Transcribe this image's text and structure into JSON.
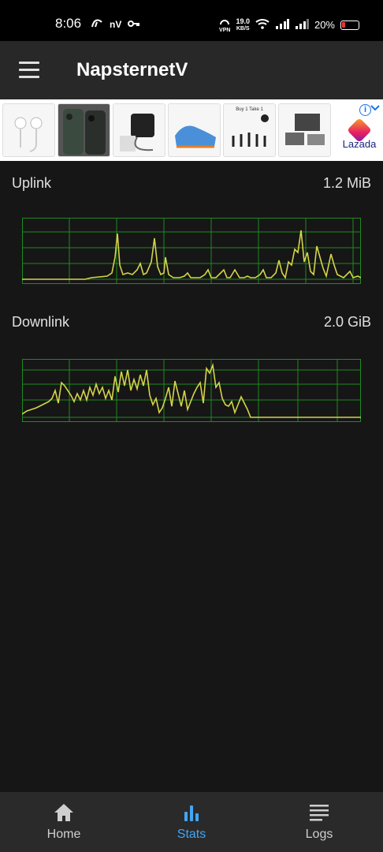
{
  "status_bar": {
    "time": "8:06",
    "carrier_badge": "nV",
    "vpn": "VPN",
    "speed_value": "19.0",
    "speed_unit": "KB/S",
    "battery": "20%"
  },
  "app": {
    "title": "NapsternetV"
  },
  "ad": {
    "brand": "Lazada",
    "info_symbol": "i",
    "thumb_text": "Buy 1 Take 1"
  },
  "uplink": {
    "label": "Uplink",
    "value": "1.2 MiB"
  },
  "downlink": {
    "label": "Downlink",
    "value": "2.0 GiB"
  },
  "nav": {
    "items": [
      {
        "label": "Home",
        "icon": "home-icon"
      },
      {
        "label": "Stats",
        "icon": "stats-icon"
      },
      {
        "label": "Logs",
        "icon": "logs-icon"
      }
    ],
    "active": "Stats"
  },
  "colors": {
    "accent": "#42a5f5",
    "graph_line": "#d4d44a",
    "graph_grid": "#1f8a1f",
    "background": "#161616",
    "app_bar": "#282828"
  }
}
